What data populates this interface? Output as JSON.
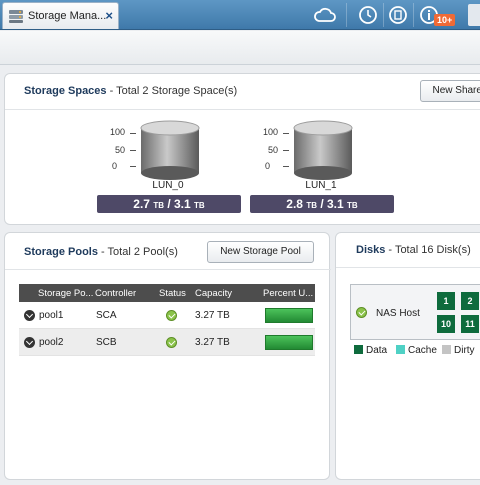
{
  "window": {
    "tab_label": "Storage Mana...",
    "notification_count": "10+"
  },
  "storage_spaces": {
    "title": "Storage Spaces",
    "subtitle": "- Total 2 Storage Space(s)",
    "new_button_label": "New Shared",
    "axis_ticks": [
      "100",
      "50",
      "0"
    ],
    "luns": [
      {
        "name": "LUN_0",
        "used": "2.7",
        "total": "3.1",
        "unit": "TB",
        "used_fraction": 0.87
      },
      {
        "name": "LUN_1",
        "used": "2.8",
        "total": "3.1",
        "unit": "TB",
        "used_fraction": 0.9
      }
    ]
  },
  "storage_pools": {
    "title": "Storage Pools",
    "subtitle": "- Total 2 Pool(s)",
    "new_button_label": "New Storage Pool",
    "columns": [
      "Storage Po...",
      "Controller",
      "Status",
      "Capacity",
      "Percent U..."
    ],
    "rows": [
      {
        "name": "pool1",
        "controller": "SCA",
        "status": "ok",
        "capacity": "3.27 TB",
        "percent_used": 1.0
      },
      {
        "name": "pool2",
        "controller": "SCB",
        "status": "ok",
        "capacity": "3.27 TB",
        "percent_used": 1.0
      }
    ]
  },
  "disks": {
    "title": "Disks",
    "subtitle": "- Total 16 Disk(s)",
    "host_label": "NAS Host",
    "visible_disks": [
      "1",
      "2",
      "10",
      "11"
    ],
    "legend": [
      {
        "label": "Data",
        "color": "#0e6b3d"
      },
      {
        "label": "Cache",
        "color": "#4fd1c5"
      },
      {
        "label": "Dirty",
        "color": "#c4c4c4"
      }
    ]
  },
  "colors": {
    "topbar": "#4a86b8",
    "capacity_bar": "#4e4967",
    "status_ok": "#8bc34a",
    "percent_bar": "#2f9b3f"
  }
}
